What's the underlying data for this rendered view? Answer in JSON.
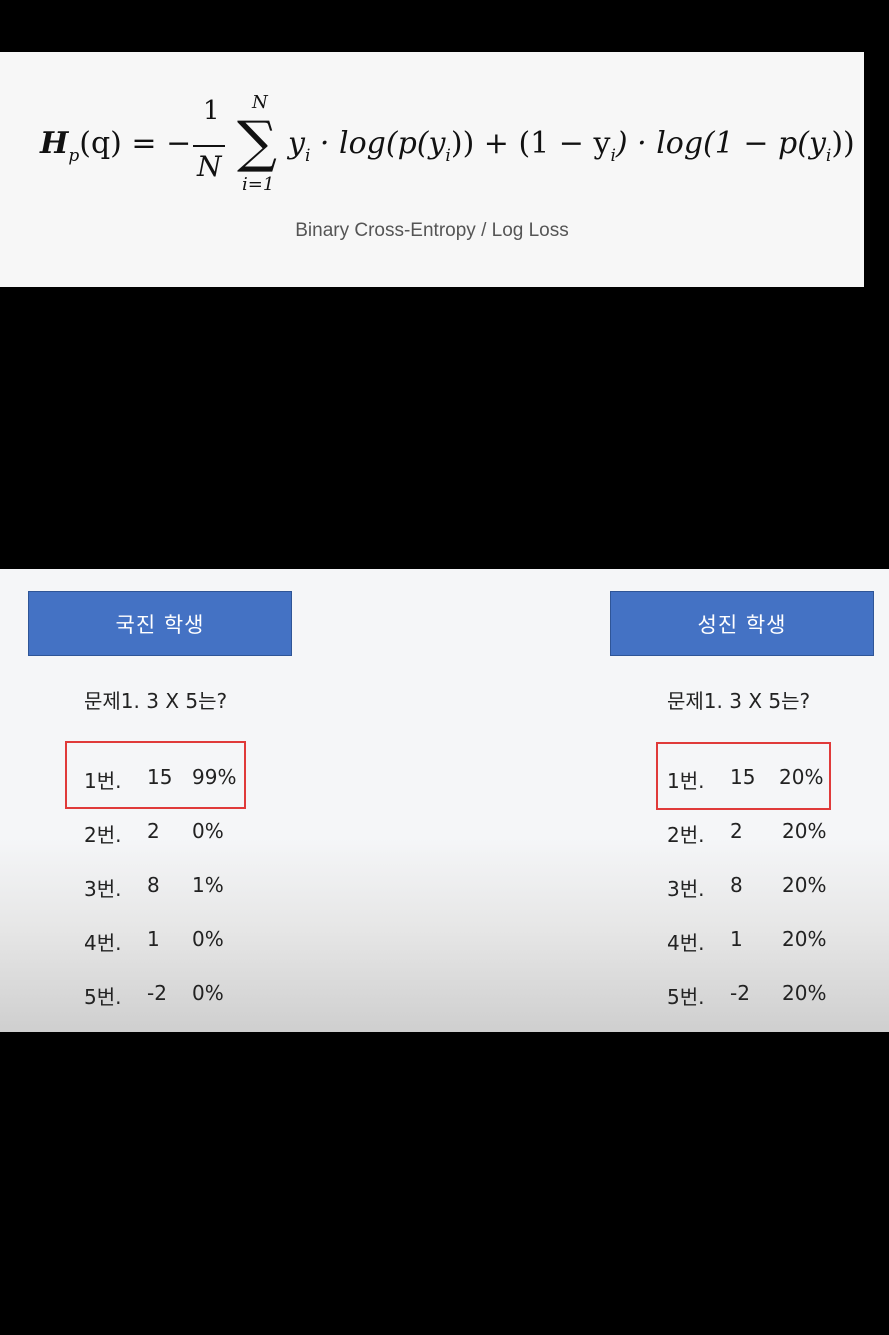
{
  "formula": {
    "H": "H",
    "p_sub": "p",
    "q_part": "(q) = −",
    "frac_num": "1",
    "frac_den": "N",
    "sigma": "∑",
    "sigma_top": "N",
    "sigma_bot": "i=1",
    "y1": "y",
    "i1": "i",
    "mid1": " · log(p(y",
    "i2": "i",
    "mid2": ")) + (1 − y",
    "i3": "i",
    "mid3": ") · log(1 − p(y",
    "i4": "i",
    "end": "))",
    "caption": "Binary Cross-Entropy / Log Loss"
  },
  "students": {
    "left": {
      "label": "국진 학생",
      "question": "문제1. 3 X 5는?",
      "options": [
        {
          "num": "1번.",
          "value": "15",
          "prob": "99%"
        },
        {
          "num": "2번.",
          "value": "2",
          "prob": "0%"
        },
        {
          "num": "3번.",
          "value": "8",
          "prob": "1%"
        },
        {
          "num": "4번.",
          "value": "1",
          "prob": "0%"
        },
        {
          "num": "5번.",
          "value": "-2",
          "prob": "0%"
        }
      ]
    },
    "right": {
      "label": "성진 학생",
      "question": "문제1. 3 X 5는?",
      "options": [
        {
          "num": "1번.",
          "value": "15",
          "prob": "20%"
        },
        {
          "num": "2번.",
          "value": "2",
          "prob": "20%"
        },
        {
          "num": "3번.",
          "value": "8",
          "prob": "20%"
        },
        {
          "num": "4번.",
          "value": "1",
          "prob": "20%"
        },
        {
          "num": "5번.",
          "value": "-2",
          "prob": "20%"
        }
      ]
    }
  },
  "colors": {
    "button_blue": "#4472c4",
    "highlight_red": "#e03a3a"
  }
}
